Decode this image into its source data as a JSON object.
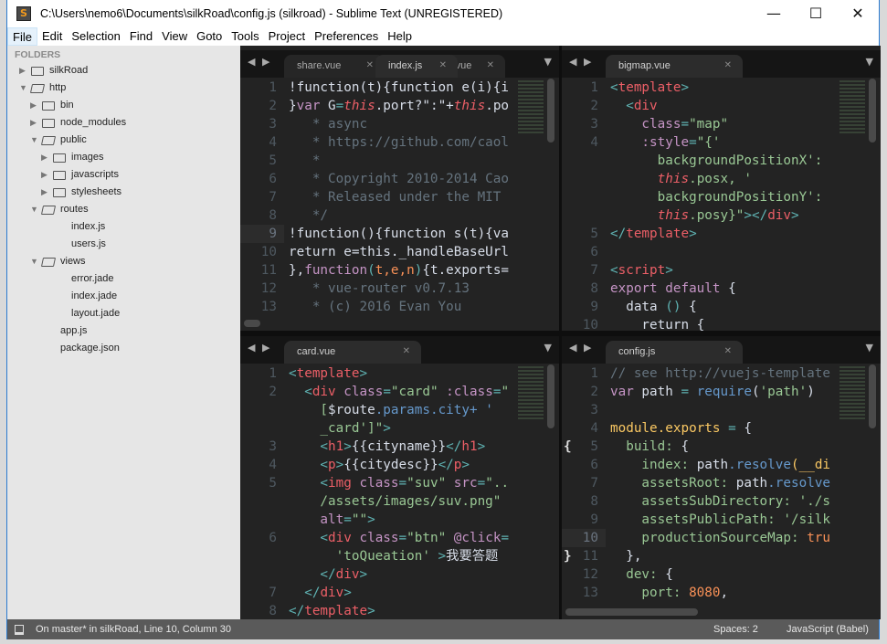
{
  "window": {
    "title": "C:\\Users\\nemo6\\Documents\\silkRoad\\config.js (silkroad) - Sublime Text (UNREGISTERED)",
    "app_icon": "S",
    "minimize": "—",
    "maximize": "☐",
    "close": "✕"
  },
  "menu": [
    "File",
    "Edit",
    "Selection",
    "Find",
    "View",
    "Goto",
    "Tools",
    "Project",
    "Preferences",
    "Help"
  ],
  "sidebar": {
    "header": "FOLDERS",
    "items": [
      {
        "label": "silkRoad",
        "depth": 0,
        "type": "folder",
        "open": false
      },
      {
        "label": "http",
        "depth": 0,
        "type": "folder",
        "open": true
      },
      {
        "label": "bin",
        "depth": 1,
        "type": "folder",
        "open": false
      },
      {
        "label": "node_modules",
        "depth": 1,
        "type": "folder",
        "open": false
      },
      {
        "label": "public",
        "depth": 1,
        "type": "folder",
        "open": true
      },
      {
        "label": "images",
        "depth": 2,
        "type": "folder",
        "open": false
      },
      {
        "label": "javascripts",
        "depth": 2,
        "type": "folder",
        "open": false
      },
      {
        "label": "stylesheets",
        "depth": 2,
        "type": "folder",
        "open": false
      },
      {
        "label": "routes",
        "depth": 1,
        "type": "folder",
        "open": true
      },
      {
        "label": "index.js",
        "depth": 2,
        "type": "file"
      },
      {
        "label": "users.js",
        "depth": 2,
        "type": "file"
      },
      {
        "label": "views",
        "depth": 1,
        "type": "folder",
        "open": true
      },
      {
        "label": "error.jade",
        "depth": 2,
        "type": "file"
      },
      {
        "label": "index.jade",
        "depth": 2,
        "type": "file"
      },
      {
        "label": "layout.jade",
        "depth": 2,
        "type": "file"
      },
      {
        "label": "app.js",
        "depth": 1,
        "type": "file"
      },
      {
        "label": "package.json",
        "depth": 1,
        "type": "file"
      }
    ]
  },
  "panes": [
    {
      "name": "top-left",
      "tabs": [
        {
          "label": "share.vue",
          "active": false
        },
        {
          "label": "index.js",
          "active": true
        },
        {
          "label": "ts.vue",
          "active": false
        }
      ],
      "current_line": "9",
      "lines": [
        {
          "n": "1",
          "tokens": [
            [
              "!function(t){function e(i){i",
              "def"
            ]
          ]
        },
        {
          "n": "2",
          "tokens": [
            [
              "}",
              "def"
            ],
            [
              "var",
              "kw"
            ],
            [
              " G",
              "def"
            ],
            [
              "=",
              "br"
            ],
            [
              "this",
              "this"
            ],
            [
              ".port?\":\"+",
              "def"
            ],
            [
              "this",
              "this"
            ],
            [
              ".po",
              "def"
            ]
          ]
        },
        {
          "n": "3",
          "tokens": [
            [
              "   * async",
              "com"
            ]
          ]
        },
        {
          "n": "4",
          "tokens": [
            [
              "   * https://github.com/caol",
              "com"
            ]
          ]
        },
        {
          "n": "5",
          "tokens": [
            [
              "   *",
              "com"
            ]
          ]
        },
        {
          "n": "6",
          "tokens": [
            [
              "   * Copyright 2010-2014 Cao",
              "com"
            ]
          ]
        },
        {
          "n": "7",
          "tokens": [
            [
              "   * Released under the MIT",
              "com"
            ]
          ]
        },
        {
          "n": "8",
          "tokens": [
            [
              "   */",
              "com"
            ]
          ]
        },
        {
          "n": "9",
          "tokens": [
            [
              "!function(){function s(t){va",
              "def"
            ]
          ]
        },
        {
          "n": "10",
          "tokens": [
            [
              "return e=this._handleBaseUrl",
              "def"
            ]
          ]
        },
        {
          "n": "11",
          "tokens": [
            [
              "},",
              "def"
            ],
            [
              "function",
              "kw"
            ],
            [
              "(",
              "br"
            ],
            [
              "t,e,n",
              "num"
            ],
            [
              ")",
              "br"
            ],
            [
              "{t.exports=",
              "def"
            ]
          ]
        },
        {
          "n": "12",
          "tokens": [
            [
              "   * vue-router v0.7.13",
              "com"
            ]
          ]
        },
        {
          "n": "13",
          "tokens": [
            [
              "   * (c) 2016 Evan You",
              "com"
            ]
          ]
        }
      ]
    },
    {
      "name": "top-right",
      "tabs": [
        {
          "label": "bigmap.vue",
          "active": true
        }
      ],
      "current_line": "",
      "lines": [
        {
          "n": "1",
          "tokens": [
            [
              "<",
              "br"
            ],
            [
              "template",
              "tag"
            ],
            [
              ">",
              "br"
            ]
          ]
        },
        {
          "n": "2",
          "tokens": [
            [
              "  <",
              "br"
            ],
            [
              "div",
              "tag"
            ]
          ]
        },
        {
          "n": "3",
          "tokens": [
            [
              "    class",
              "attr"
            ],
            [
              "=",
              "br"
            ],
            [
              "\"map\"",
              "str"
            ]
          ]
        },
        {
          "n": "4",
          "tokens": [
            [
              "    :style",
              "attr"
            ],
            [
              "=",
              "br"
            ],
            [
              "\"{'",
              "str"
            ]
          ]
        },
        {
          "n": "",
          "tokens": [
            [
              "      backgroundPositionX':",
              "str"
            ]
          ]
        },
        {
          "n": "",
          "tokens": [
            [
              "      ",
              "def"
            ],
            [
              "this",
              "this"
            ],
            [
              ".posx, '",
              "str"
            ]
          ]
        },
        {
          "n": "",
          "tokens": [
            [
              "      backgroundPositionY':",
              "str"
            ]
          ]
        },
        {
          "n": "",
          "tokens": [
            [
              "      ",
              "def"
            ],
            [
              "this",
              "this"
            ],
            [
              ".posy}\"",
              "str"
            ],
            [
              "></",
              "br"
            ],
            [
              "div",
              "tag"
            ],
            [
              ">",
              "br"
            ]
          ]
        },
        {
          "n": "5",
          "tokens": [
            [
              "</",
              "br"
            ],
            [
              "template",
              "tag"
            ],
            [
              ">",
              "br"
            ]
          ]
        },
        {
          "n": "6",
          "tokens": [
            [
              "",
              "def"
            ]
          ]
        },
        {
          "n": "7",
          "tokens": [
            [
              "<",
              "br"
            ],
            [
              "script",
              "tag"
            ],
            [
              ">",
              "br"
            ]
          ]
        },
        {
          "n": "8",
          "tokens": [
            [
              "export default",
              "attr"
            ],
            [
              " {",
              "def"
            ]
          ]
        },
        {
          "n": "9",
          "tokens": [
            [
              "  data ",
              "def"
            ],
            [
              "()",
              "br"
            ],
            [
              " {",
              "def"
            ]
          ]
        },
        {
          "n": "10",
          "tokens": [
            [
              "    return {",
              "def"
            ]
          ]
        }
      ]
    },
    {
      "name": "bottom-left",
      "tabs": [
        {
          "label": "card.vue",
          "active": true
        }
      ],
      "current_line": "",
      "lines": [
        {
          "n": "1",
          "tokens": [
            [
              "<",
              "br"
            ],
            [
              "template",
              "tag"
            ],
            [
              ">",
              "br"
            ]
          ]
        },
        {
          "n": "2",
          "tokens": [
            [
              "  <",
              "br"
            ],
            [
              "div",
              "tag"
            ],
            [
              " class",
              "attr"
            ],
            [
              "=",
              "br"
            ],
            [
              "\"card\"",
              "str"
            ],
            [
              " :class",
              "attr"
            ],
            [
              "=",
              "br"
            ],
            [
              "\"",
              "str"
            ]
          ]
        },
        {
          "n": "",
          "tokens": [
            [
              "    [",
              "str"
            ],
            [
              "$route",
              "def"
            ],
            [
              ".params.city+ '",
              "fn"
            ]
          ]
        },
        {
          "n": "",
          "tokens": [
            [
              "    _card']\"",
              "str"
            ],
            [
              ">",
              "br"
            ]
          ]
        },
        {
          "n": "3",
          "tokens": [
            [
              "    <",
              "br"
            ],
            [
              "h1",
              "tag"
            ],
            [
              ">",
              "br"
            ],
            [
              "{{cityname}}",
              "def"
            ],
            [
              "</",
              "br"
            ],
            [
              "h1",
              "tag"
            ],
            [
              ">",
              "br"
            ]
          ]
        },
        {
          "n": "4",
          "tokens": [
            [
              "    <",
              "br"
            ],
            [
              "p",
              "tag"
            ],
            [
              ">",
              "br"
            ],
            [
              "{{citydesc}}",
              "def"
            ],
            [
              "</",
              "br"
            ],
            [
              "p",
              "tag"
            ],
            [
              ">",
              "br"
            ]
          ]
        },
        {
          "n": "5",
          "tokens": [
            [
              "    <",
              "br"
            ],
            [
              "img",
              "tag"
            ],
            [
              " class",
              "attr"
            ],
            [
              "=",
              "br"
            ],
            [
              "\"suv\"",
              "str"
            ],
            [
              " src",
              "attr"
            ],
            [
              "=",
              "br"
            ],
            [
              "\"..",
              "str"
            ]
          ]
        },
        {
          "n": "",
          "tokens": [
            [
              "    /assets/images/suv.png\"",
              "str"
            ]
          ]
        },
        {
          "n": "",
          "tokens": [
            [
              "    alt",
              "attr"
            ],
            [
              "=",
              "br"
            ],
            [
              "\"\"",
              "str"
            ],
            [
              ">",
              "br"
            ]
          ]
        },
        {
          "n": "6",
          "tokens": [
            [
              "    <",
              "br"
            ],
            [
              "div",
              "tag"
            ],
            [
              " class",
              "attr"
            ],
            [
              "=",
              "br"
            ],
            [
              "\"btn\"",
              "str"
            ],
            [
              " @click",
              "attr"
            ],
            [
              "=",
              "br"
            ]
          ]
        },
        {
          "n": "",
          "tokens": [
            [
              "      'toQueation'",
              "str"
            ],
            [
              " >",
              "br"
            ],
            [
              "我要答题",
              "def"
            ]
          ]
        },
        {
          "n": "",
          "tokens": [
            [
              "    </",
              "br"
            ],
            [
              "div",
              "tag"
            ],
            [
              ">",
              "br"
            ]
          ]
        },
        {
          "n": "7",
          "tokens": [
            [
              "  </",
              "br"
            ],
            [
              "div",
              "tag"
            ],
            [
              ">",
              "br"
            ]
          ]
        },
        {
          "n": "8",
          "tokens": [
            [
              "</",
              "br"
            ],
            [
              "template",
              "tag"
            ],
            [
              ">",
              "br"
            ]
          ]
        }
      ]
    },
    {
      "name": "bottom-right",
      "tabs": [
        {
          "label": "config.js",
          "active": true
        }
      ],
      "current_line": "10",
      "lines": [
        {
          "n": "1",
          "tokens": [
            [
              "// see http://vuejs-template",
              "com"
            ]
          ]
        },
        {
          "n": "2",
          "tokens": [
            [
              "var",
              "kw"
            ],
            [
              " path ",
              "def"
            ],
            [
              "=",
              "br"
            ],
            [
              " require",
              "fn"
            ],
            [
              "(",
              "def"
            ],
            [
              "'path'",
              "str"
            ],
            [
              ")",
              "def"
            ]
          ]
        },
        {
          "n": "3",
          "tokens": [
            [
              "",
              "def"
            ]
          ]
        },
        {
          "n": "4",
          "tokens": [
            [
              "module",
              "obj"
            ],
            [
              ".exports ",
              "obj"
            ],
            [
              "=",
              "br"
            ],
            [
              " {",
              "def"
            ]
          ]
        },
        {
          "n": "5",
          "tokens": [
            [
              "  build: ",
              "prop"
            ],
            [
              "{",
              "def"
            ]
          ]
        },
        {
          "n": "6",
          "tokens": [
            [
              "    index: ",
              "prop"
            ],
            [
              "path",
              "def"
            ],
            [
              ".resolve",
              "fn"
            ],
            [
              "(__di",
              "obj"
            ]
          ]
        },
        {
          "n": "7",
          "tokens": [
            [
              "    assetsRoot: ",
              "prop"
            ],
            [
              "path",
              "def"
            ],
            [
              ".resolve",
              "fn"
            ]
          ]
        },
        {
          "n": "8",
          "tokens": [
            [
              "    assetsSubDirectory: './s",
              "prop"
            ]
          ]
        },
        {
          "n": "9",
          "tokens": [
            [
              "    assetsPublicPath: '/silk",
              "prop"
            ]
          ]
        },
        {
          "n": "10",
          "tokens": [
            [
              "    productionSourceMap: ",
              "prop"
            ],
            [
              "tru",
              "num"
            ]
          ]
        },
        {
          "n": "11",
          "tokens": [
            [
              "  },",
              "def"
            ]
          ]
        },
        {
          "n": "12",
          "tokens": [
            [
              "  dev: ",
              "prop"
            ],
            [
              "{",
              "def"
            ]
          ]
        },
        {
          "n": "13",
          "tokens": [
            [
              "    port: ",
              "prop"
            ],
            [
              "8080",
              "num"
            ],
            [
              ",",
              "def"
            ]
          ]
        }
      ]
    }
  ],
  "fold_markers": {
    "open": "{",
    "close": "}"
  },
  "statusbar": {
    "icon": "panel-icon",
    "text": "On master* in silkRoad, Line 10, Column 30",
    "spaces": "Spaces: 2",
    "syntax": "JavaScript (Babel)"
  }
}
